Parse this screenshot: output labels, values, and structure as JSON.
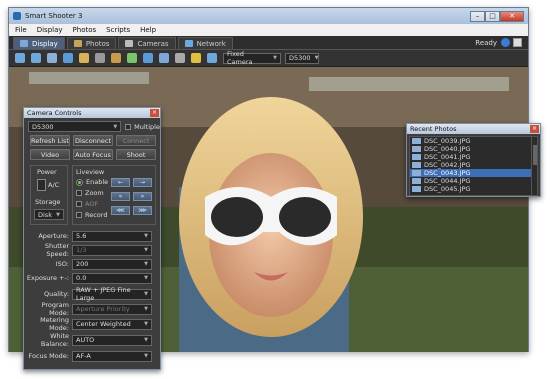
{
  "window": {
    "title": "Smart Shooter 3"
  },
  "menu": [
    "File",
    "Display",
    "Photos",
    "Scripts",
    "Help"
  ],
  "tabs": [
    {
      "label": "Display",
      "active": true
    },
    {
      "label": "Photos",
      "active": false
    },
    {
      "label": "Cameras",
      "active": false
    },
    {
      "label": "Network",
      "active": false
    }
  ],
  "status": {
    "ready": "Ready"
  },
  "toolbar": {
    "camera_mode": "Fixed Camera",
    "camera_model": "D5300"
  },
  "camera_controls": {
    "title": "Camera Controls",
    "camera_select": "D5300",
    "multiple_label": "Multiple",
    "buttons": {
      "refresh": "Refresh List",
      "disconnect": "Disconnect",
      "connect": "Connect",
      "video": "Video",
      "autofocus": "Auto Focus",
      "shoot": "Shoot"
    },
    "power": {
      "label": "Power",
      "value": "A/C"
    },
    "storage": {
      "label": "Storage",
      "value": "Disk"
    },
    "liveview": {
      "label": "Liveview",
      "enable": "Enable",
      "zoom": "Zoom",
      "aof": "AOF",
      "record": "Record"
    },
    "properties": [
      {
        "label": "Aperture:",
        "value": "5.6",
        "disabled": false
      },
      {
        "label": "Shutter Speed:",
        "value": "1/3",
        "disabled": true
      },
      {
        "label": "ISO:",
        "value": "200",
        "disabled": false
      },
      {
        "label": "Exposure +-:",
        "value": "0.0",
        "disabled": false
      },
      {
        "label": "Quality:",
        "value": "RAW + JPEG Fine Large",
        "disabled": false
      },
      {
        "label": "Program Mode:",
        "value": "Aperture Priority",
        "disabled": true
      },
      {
        "label": "Metering Mode:",
        "value": "Center Weighted",
        "disabled": false
      },
      {
        "label": "White Balance:",
        "value": "AUTO",
        "disabled": false
      },
      {
        "label": "Focus Mode:",
        "value": "AF-A",
        "disabled": false
      }
    ]
  },
  "recent_photos": {
    "title": "Recent Photos",
    "items": [
      "DSC_0039.JPG",
      "DSC_0040.JPG",
      "DSC_0041.JPG",
      "DSC_0042.JPG",
      "DSC_0043.JPG",
      "DSC_0044.JPG",
      "DSC_0045.JPG"
    ],
    "selected_index": 4
  },
  "colors": {
    "accent": "#3d6eb8",
    "titlebar": "#b7c7da",
    "panel": "#3d3d3d"
  }
}
